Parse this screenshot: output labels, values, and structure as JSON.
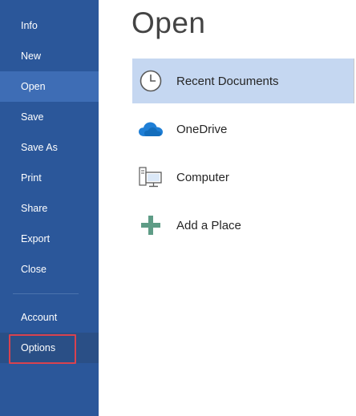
{
  "nav": {
    "items": [
      {
        "id": "info",
        "label": "Info",
        "selected": false
      },
      {
        "id": "new",
        "label": "New",
        "selected": false
      },
      {
        "id": "open",
        "label": "Open",
        "selected": true
      },
      {
        "id": "save",
        "label": "Save",
        "selected": false
      },
      {
        "id": "save-as",
        "label": "Save As",
        "selected": false
      },
      {
        "id": "print",
        "label": "Print",
        "selected": false
      },
      {
        "id": "share",
        "label": "Share",
        "selected": false
      },
      {
        "id": "export",
        "label": "Export",
        "selected": false
      },
      {
        "id": "close",
        "label": "Close",
        "selected": false
      },
      {
        "id": "account",
        "label": "Account",
        "selected": false
      },
      {
        "id": "options",
        "label": "Options",
        "selected": false,
        "highlighted": true
      }
    ]
  },
  "main": {
    "title": "Open",
    "locations": [
      {
        "id": "recent-documents",
        "label": "Recent Documents",
        "icon": "clock-icon",
        "selected": true
      },
      {
        "id": "onedrive",
        "label": "OneDrive",
        "icon": "cloud-icon",
        "selected": false
      },
      {
        "id": "computer",
        "label": "Computer",
        "icon": "computer-icon",
        "selected": false
      },
      {
        "id": "add-a-place",
        "label": "Add a Place",
        "icon": "plus-icon",
        "selected": false
      }
    ]
  },
  "colors": {
    "nav_background": "#2b579a",
    "nav_selected": "#3e6db5",
    "location_selected": "#c5d7f1",
    "highlight_border": "#d9424f"
  }
}
